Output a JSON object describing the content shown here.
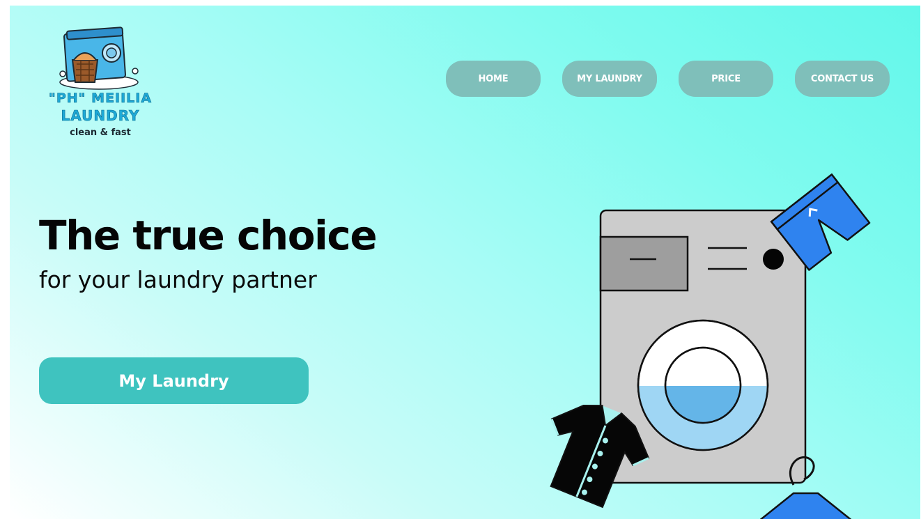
{
  "brand": {
    "name_line1": "\"PH\" MEIILIA",
    "name_line2": "LAUNDRY",
    "tagline": "clean & fast"
  },
  "nav": {
    "items": [
      {
        "label": "HOME"
      },
      {
        "label": "MY LAUNDRY"
      },
      {
        "label": "PRICE"
      },
      {
        "label": "CONTACT US"
      }
    ]
  },
  "hero": {
    "title": "The true choice",
    "subtitle": "for your laundry partner",
    "cta_label": "My Laundry"
  },
  "colors": {
    "nav_button": "#7fbfba",
    "cta_button": "#3fc3bf",
    "background_start": "#ffffff",
    "background_end": "#62f7ea",
    "brand_text": "#1ea9d6"
  },
  "icons": {
    "logo": "washing-machine-logo",
    "illustration": "washing-machine-with-clothes"
  }
}
